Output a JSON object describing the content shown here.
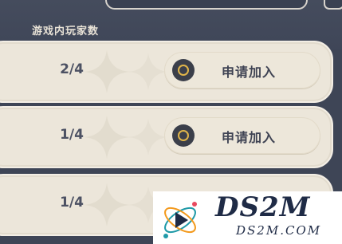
{
  "header": {
    "title": "游戏内玩家数"
  },
  "rows": [
    {
      "count": "2/4",
      "button_label": "申请加入"
    },
    {
      "count": "1/4",
      "button_label": "申请加入"
    },
    {
      "count": "1/4",
      "button_label": ""
    }
  ],
  "watermark": {
    "title": "DS2M",
    "subtitle": "DS2M.COM"
  },
  "colors": {
    "background": "#3e4556",
    "row": "#ece6da",
    "accent": "#e0b54a"
  },
  "icons": [
    "join-circle-icon"
  ]
}
